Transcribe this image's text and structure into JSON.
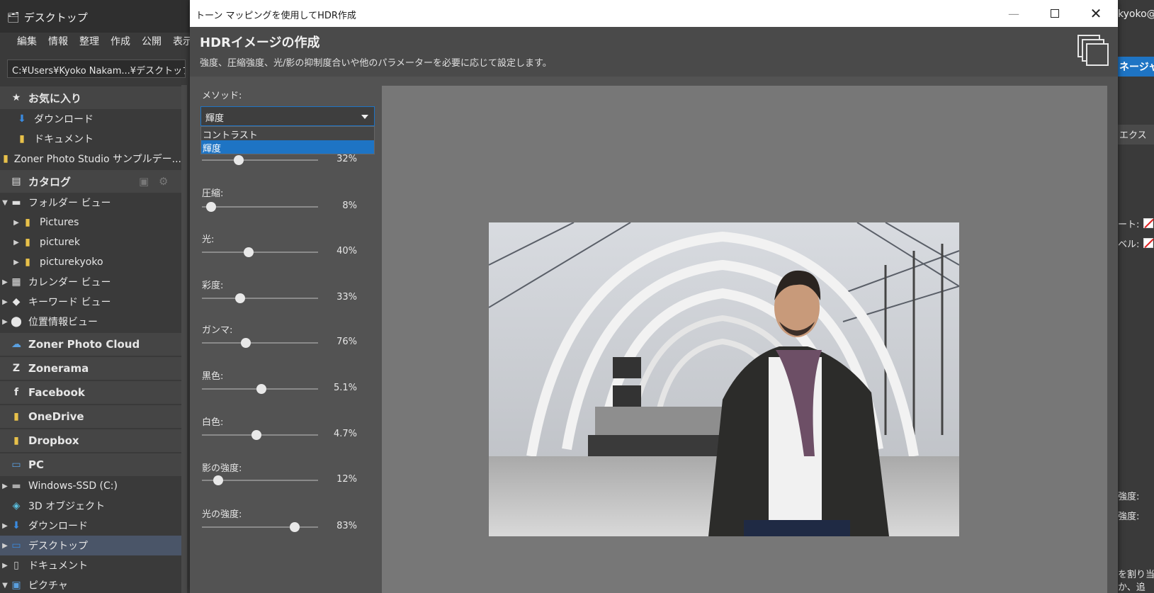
{
  "background_app": {
    "title": "デスクトップ",
    "menu": [
      "",
      "編集",
      "情報",
      "整理",
      "作成",
      "公開",
      "表示"
    ],
    "path": "C:¥Users¥Kyoko Nakam...¥デスクトップ",
    "sidebar": {
      "favorites_title": "お気に入り",
      "favorites": [
        "ダウンロード",
        "ドキュメント",
        "Zoner Photo Studio サンプルデー..."
      ],
      "catalog_title": "カタログ",
      "folder_view": "フォルダー ビュー",
      "folders": [
        "Pictures",
        "picturek",
        "picturekyoko"
      ],
      "views": [
        "カレンダー ビュー",
        "キーワード ビュー",
        "位置情報ビュー"
      ],
      "services": [
        "Zoner Photo Cloud",
        "Zonerama",
        "Facebook",
        "OneDrive",
        "Dropbox"
      ],
      "pc_title": "PC",
      "pc_items": [
        "Windows-SSD (C:)",
        "3D オブジェクト",
        "ダウンロード",
        "デスクトップ",
        "ドキュメント",
        "ピクチャ"
      ]
    },
    "right": {
      "user": "kyoko@",
      "manage_button": "ネージャ",
      "export_button": "エクス",
      "labels": [
        "ート:",
        "ベル:",
        "強度:",
        "強度:",
        "を割り当",
        "か、追"
      ]
    }
  },
  "dialog": {
    "window_title": "トーン マッピングを使用してHDR作成",
    "heading": "HDRイメージの作成",
    "subtitle": "強度、圧縮強度、光/影の抑制度合いや他のパラメーターを必要に応じて設定します。",
    "method": {
      "label": "メソッド:",
      "value": "輝度",
      "options": [
        "コントラスト",
        "輝度"
      ],
      "selected_index": 1
    },
    "params": [
      {
        "label": "",
        "value": 0.32,
        "display": "32%"
      },
      {
        "label": "圧縮:",
        "value": 0.08,
        "display": "8%"
      },
      {
        "label": "光:",
        "value": 0.4,
        "display": "40%"
      },
      {
        "label": "彩度:",
        "value": 0.33,
        "display": "33%"
      },
      {
        "label": "ガンマ:",
        "value": 0.38,
        "display": "76%"
      },
      {
        "label": "黒色:",
        "value": 0.51,
        "display": "5.1%"
      },
      {
        "label": "白色:",
        "value": 0.47,
        "display": "4.7%"
      },
      {
        "label": "影の強度:",
        "value": 0.14,
        "display": "12%"
      },
      {
        "label": "光の強度:",
        "value": 0.8,
        "display": "83%"
      }
    ]
  },
  "colors": {
    "accent": "#1e74c4",
    "dialog_bg": "#535353",
    "preview_bg": "#777777"
  }
}
